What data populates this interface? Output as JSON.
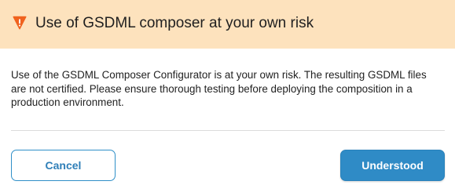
{
  "dialog": {
    "title": "Use of GSDML composer at your own risk",
    "message": "Use of the GSDML Composer Configurator is at your own risk. The resulting GSDML files are not certified. Please ensure thorough testing before deploying the composition in a production environment.",
    "icons": {
      "title_icon": "warning-icon"
    },
    "buttons": {
      "cancel_label": "Cancel",
      "confirm_label": "Understood"
    }
  },
  "colors": {
    "header_background": "#fde2bd",
    "warning_icon": "#f0621e",
    "primary_button": "#2f8bc6",
    "secondary_button_text": "#2f7fb8"
  }
}
